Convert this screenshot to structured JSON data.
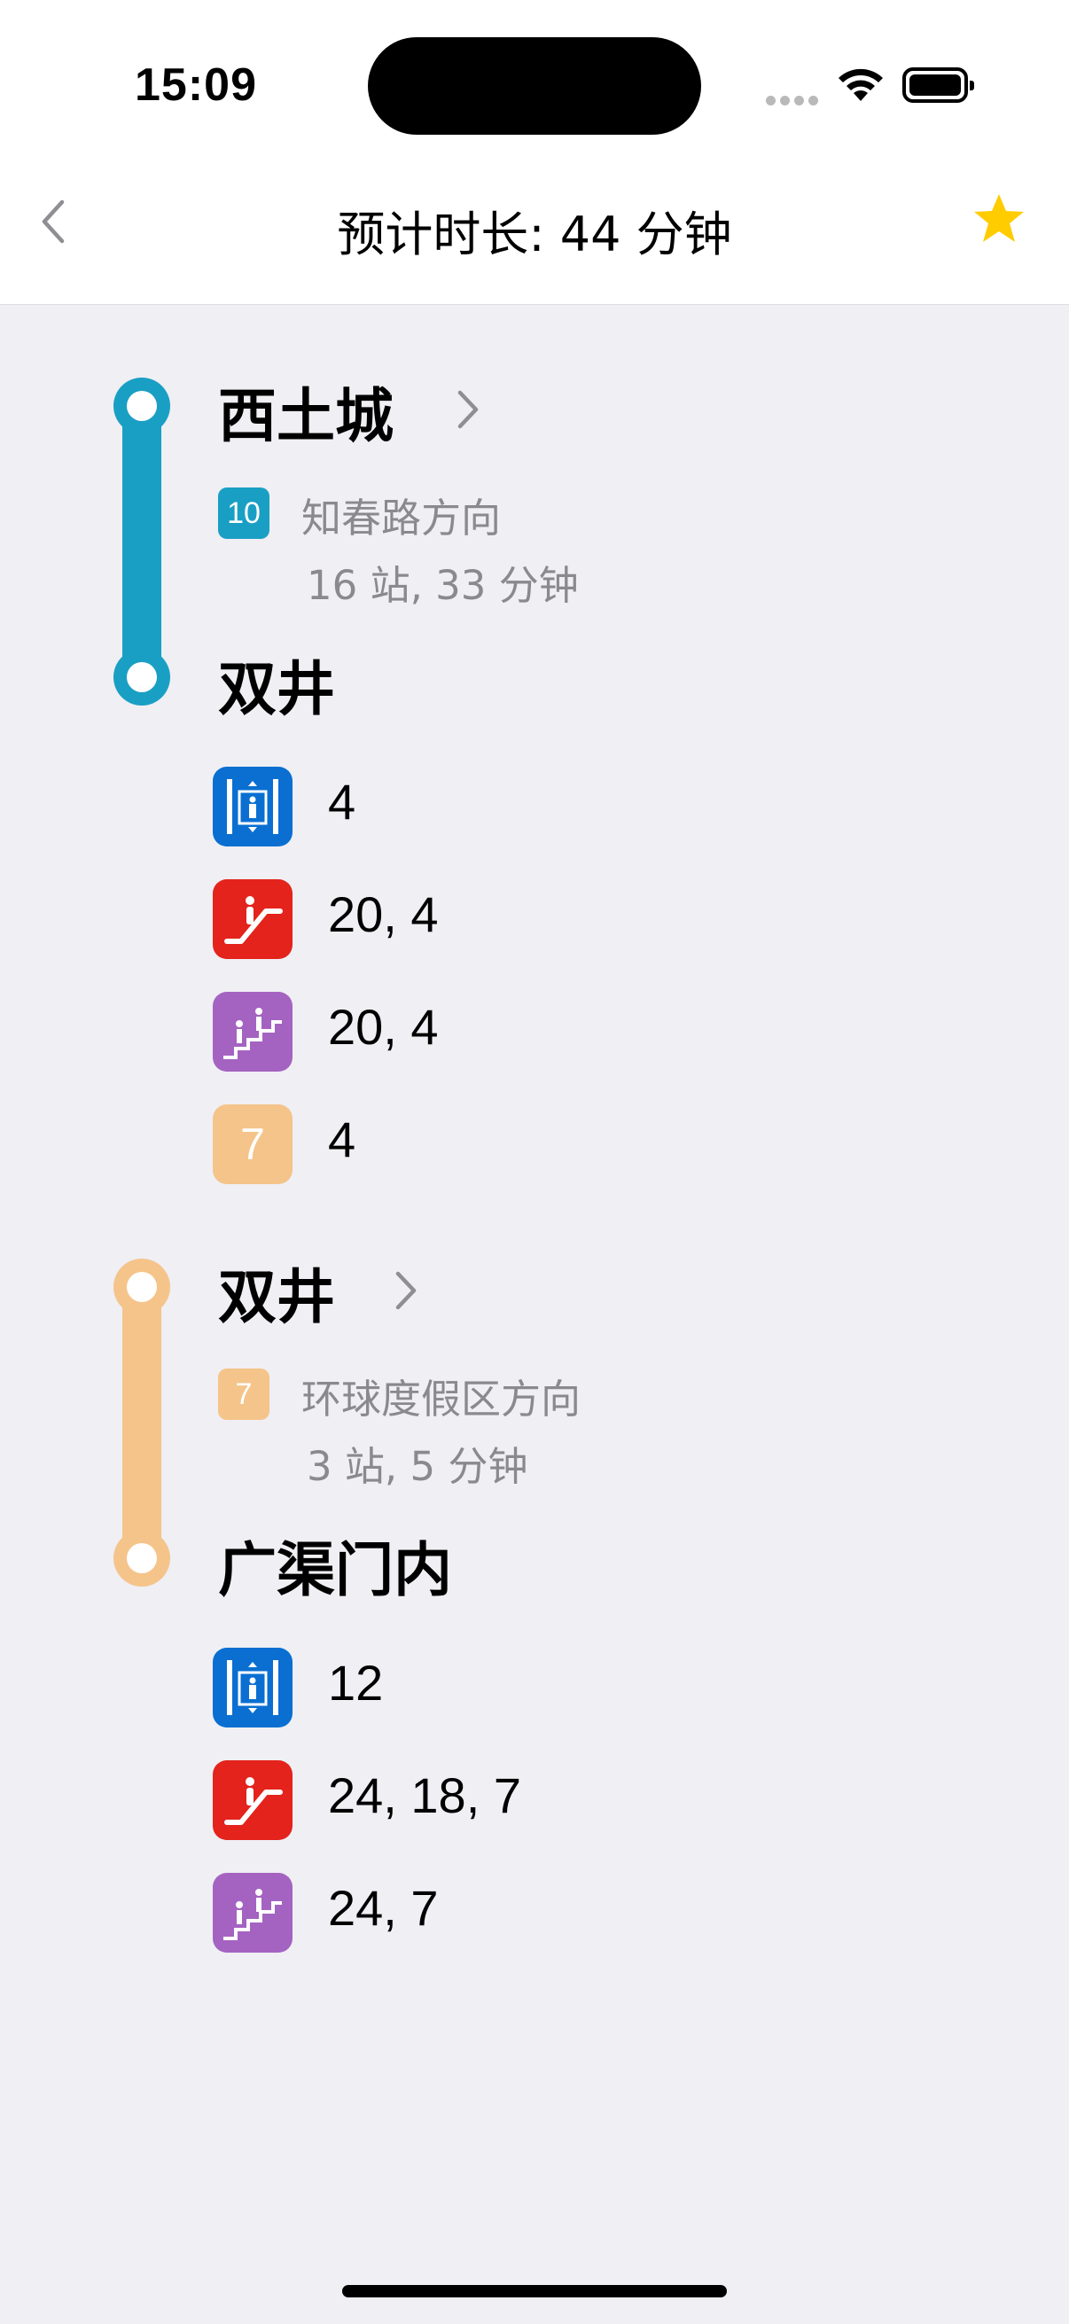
{
  "status_bar": {
    "time": "15:09"
  },
  "nav": {
    "title": "预计时长: 44 分钟",
    "back_icon": "chevron-left-icon",
    "favorite_icon": "star-icon"
  },
  "colors": {
    "line10": "#1a9fc4",
    "line7": "#f5c48a",
    "elevator": "#0a6fd1",
    "escalator": "#e3231c",
    "stairs": "#a463c1",
    "favorite": "#ffcc00"
  },
  "legs": [
    {
      "from_station": "西土城",
      "line_badge": "10",
      "direction": "知春路方向",
      "summary": "16 站, 33 分钟",
      "to_station": "双井",
      "facilities": [
        {
          "icon": "elevator-icon",
          "value": "4"
        },
        {
          "icon": "escalator-icon",
          "value": "20, 4"
        },
        {
          "icon": "stairs-icon",
          "value": "20, 4"
        },
        {
          "icon": "line-7-icon",
          "badge": "7",
          "value": "4"
        }
      ]
    },
    {
      "from_station": "双井",
      "line_badge": "7",
      "direction": "环球度假区方向",
      "summary": "3 站, 5 分钟",
      "to_station": "广渠门内",
      "facilities": [
        {
          "icon": "elevator-icon",
          "value": "12"
        },
        {
          "icon": "escalator-icon",
          "value": "24, 18, 7"
        },
        {
          "icon": "stairs-icon",
          "value": "24, 7"
        }
      ]
    }
  ]
}
